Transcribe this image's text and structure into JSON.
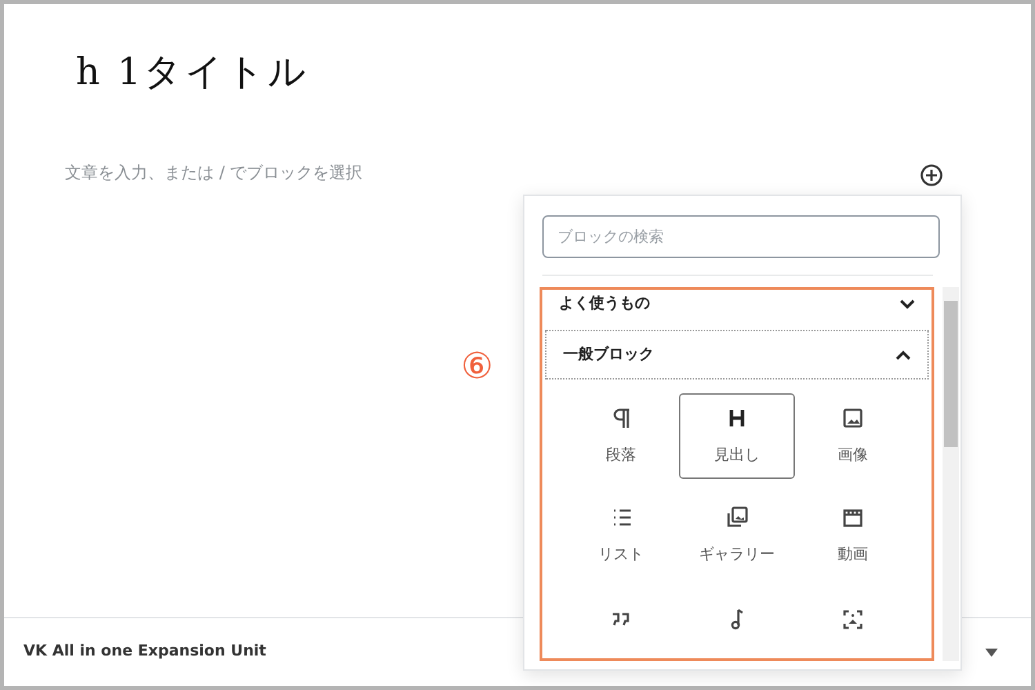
{
  "title": "h 1タイトル",
  "paragraph_placeholder": "文章を入力、または / でブロックを選択",
  "annotation": "⑥",
  "inserter": {
    "search": {
      "placeholder": "ブロックの検索"
    },
    "panels": [
      {
        "label": "よく使うもの",
        "expanded": false,
        "focused": false
      },
      {
        "label": "一般ブロック",
        "expanded": true,
        "focused": true
      }
    ],
    "blocks": [
      {
        "kind": "paragraph",
        "label": "段落",
        "selected": false
      },
      {
        "kind": "heading",
        "label": "見出し",
        "selected": true
      },
      {
        "kind": "image",
        "label": "画像",
        "selected": false
      },
      {
        "kind": "list",
        "label": "リスト",
        "selected": false
      },
      {
        "kind": "gallery",
        "label": "ギャラリー",
        "selected": false
      },
      {
        "kind": "video",
        "label": "動画",
        "selected": false
      },
      {
        "kind": "quote",
        "selected": false
      },
      {
        "kind": "audio",
        "selected": false
      },
      {
        "kind": "cover",
        "selected": false
      }
    ]
  },
  "footer": {
    "label": "VK All in one Expansion Unit"
  }
}
